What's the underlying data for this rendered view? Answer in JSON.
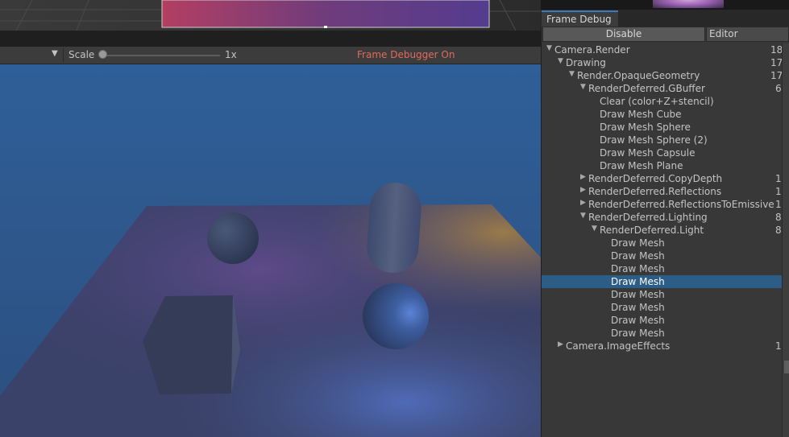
{
  "toolbar": {
    "dropdown_icon": "chevron-down-icon",
    "scale_label": "Scale",
    "scale_value": "1x",
    "scale_slider_fraction": 0.0,
    "status_text": "Frame Debugger On",
    "status_color": "#e26a5a"
  },
  "panel": {
    "tab_title": "Frame Debug",
    "disable_label": "Disable",
    "editor_label": "Editor"
  },
  "tree": [
    {
      "label": "Camera.Render",
      "count": "18",
      "depth": 0,
      "expanded": true
    },
    {
      "label": "Drawing",
      "count": "17",
      "depth": 1,
      "expanded": true
    },
    {
      "label": "Render.OpaqueGeometry",
      "count": "17",
      "depth": 2,
      "expanded": true
    },
    {
      "label": "RenderDeferred.GBuffer",
      "count": "6",
      "depth": 3,
      "expanded": true
    },
    {
      "label": "Clear (color+Z+stencil)",
      "count": "",
      "depth": 4
    },
    {
      "label": "Draw Mesh Cube",
      "count": "",
      "depth": 4
    },
    {
      "label": "Draw Mesh Sphere",
      "count": "",
      "depth": 4
    },
    {
      "label": "Draw Mesh Sphere (2)",
      "count": "",
      "depth": 4
    },
    {
      "label": "Draw Mesh Capsule",
      "count": "",
      "depth": 4
    },
    {
      "label": "Draw Mesh Plane",
      "count": "",
      "depth": 4
    },
    {
      "label": "RenderDeferred.CopyDepth",
      "count": "1",
      "depth": 3,
      "expanded": false
    },
    {
      "label": "RenderDeferred.Reflections",
      "count": "1",
      "depth": 3,
      "expanded": false
    },
    {
      "label": "RenderDeferred.ReflectionsToEmissive",
      "count": "1",
      "depth": 3,
      "expanded": false
    },
    {
      "label": "RenderDeferred.Lighting",
      "count": "8",
      "depth": 3,
      "expanded": true
    },
    {
      "label": "RenderDeferred.Light",
      "count": "8",
      "depth": 4,
      "expanded": true
    },
    {
      "label": "Draw Mesh",
      "count": "",
      "depth": 5
    },
    {
      "label": "Draw Mesh",
      "count": "",
      "depth": 5
    },
    {
      "label": "Draw Mesh",
      "count": "",
      "depth": 5
    },
    {
      "label": "Draw Mesh",
      "count": "",
      "depth": 5,
      "selected": true
    },
    {
      "label": "Draw Mesh",
      "count": "",
      "depth": 5
    },
    {
      "label": "Draw Mesh",
      "count": "",
      "depth": 5
    },
    {
      "label": "Draw Mesh",
      "count": "",
      "depth": 5
    },
    {
      "label": "Draw Mesh",
      "count": "",
      "depth": 5
    },
    {
      "label": "Camera.ImageEffects",
      "count": "1",
      "depth": 1,
      "expanded": false
    }
  ],
  "colors": {
    "selection": "#2c5d87",
    "tab_accent": "#3a79bb"
  }
}
